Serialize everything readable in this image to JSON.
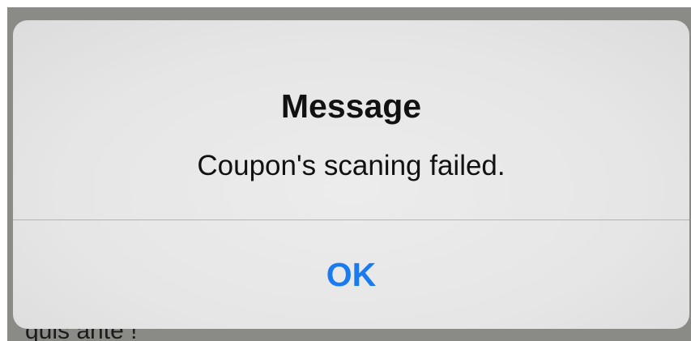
{
  "background": {
    "text": "quis ante !"
  },
  "alert": {
    "title": "Message",
    "message": "Coupon's scaning failed.",
    "ok_label": "OK"
  },
  "colors": {
    "accent": "#1a7bf0",
    "alert_background": "#e8e8e8",
    "overlay": "#8a8a86"
  }
}
